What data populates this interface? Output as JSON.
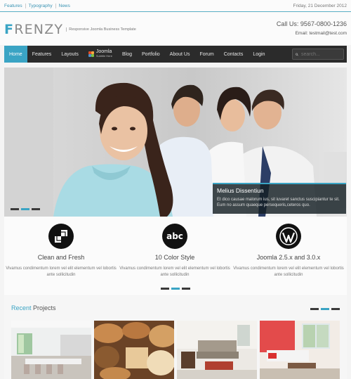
{
  "topbar": {
    "links": [
      "Features",
      "Typography",
      "News"
    ],
    "date": "Friday, 21 December 2012"
  },
  "header": {
    "logo_first": "F",
    "logo_rest": "RENZY",
    "tagline": "Responsive Joomla Business Template",
    "call": "Call Us: 9567-0800-1236",
    "email": "Email: testmail@test.com"
  },
  "nav": {
    "items": [
      "Home",
      "Features",
      "Layouts",
      "Joomla",
      "Blog",
      "Portfolio",
      "About Us",
      "Forum",
      "Contacts",
      "Login"
    ],
    "joomla_sub": "Subtitle Here",
    "search_placeholder": "search..."
  },
  "slider": {
    "caption_title": "Melius Dissentiun",
    "caption_text": "Et dico causae malorum ius, sit iuvaret sanctus suscipiantur te sit. Eum no assum quaeque persequeris,ceteros quo."
  },
  "features": [
    {
      "icon": "checkerboard-icon",
      "title": "Clean and Fresh",
      "text": "Vivamus condimentum lorem vel elit elementum vel lobortis ante sollicitudin"
    },
    {
      "icon": "abc-icon",
      "icon_text": "abc",
      "title": "10 Color Style",
      "text": "Vivamus condimentum lorem vel elit elementum vel lobortis ante sollicitudin"
    },
    {
      "icon": "wordpress-icon",
      "title": "Joomla 2.5.x and 3.0.x",
      "text": "Vivamus condimentum lorem vel elit elementum vel lobortis ante sollicitudin"
    }
  ],
  "recent": {
    "title_accent": "Recent",
    "title_rest": " Projects"
  },
  "colors": {
    "accent": "#3aa4c4",
    "nav_bg": "#2b2b2b"
  }
}
